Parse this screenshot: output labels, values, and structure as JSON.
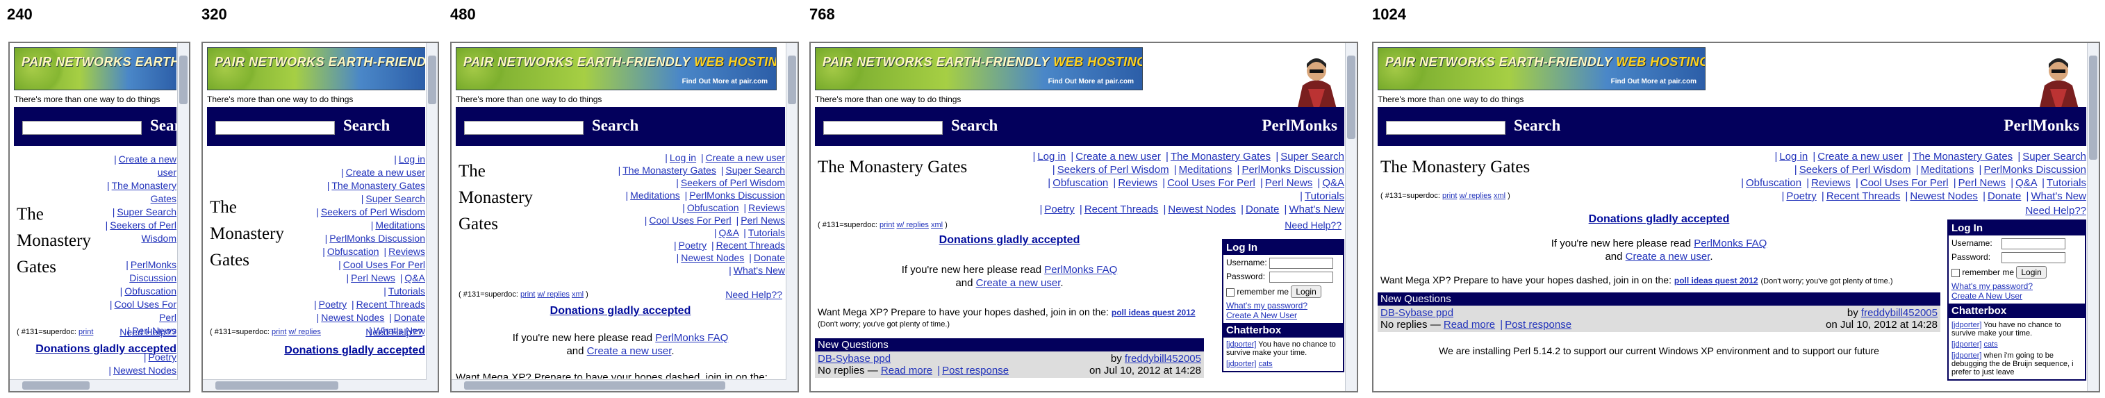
{
  "viewports": [
    {
      "label": "240"
    },
    {
      "label": "320"
    },
    {
      "label": "480"
    },
    {
      "label": "768"
    },
    {
      "label": "1024"
    }
  ],
  "banner": {
    "headline_a": "PAIR NETWORKS",
    "headline_b": "EARTH-FRIENDLY",
    "headline_c": "WEB HOSTING",
    "sub": "Find Out More at pair.com"
  },
  "tagline": "There's more than one way to do things",
  "search_label": "Search",
  "site_name": "PerlMonks",
  "page_title": "The Monastery Gates",
  "title_words": [
    "The",
    "Monastery",
    "Gates"
  ],
  "nav_links": [
    "Log in",
    "Create a new user",
    "The Monastery Gates",
    "Super Search",
    "Seekers of Perl Wisdom",
    "Meditations",
    "PerlMonks Discussion",
    "Obfuscation",
    "Reviews",
    "Cool Uses For Perl",
    "Perl News",
    "Q&A",
    "Tutorials",
    "Poetry",
    "Recent Threads",
    "Newest Nodes",
    "Donate",
    "What's New"
  ],
  "superdoc": {
    "prefix": "( #131=superdoc:",
    "print": "print",
    "replies": "w/ replies",
    "xml": "xml",
    "suffix": ")"
  },
  "need_help": "Need Help??",
  "donations": "Donations gladly accepted",
  "faq_line": {
    "pre": "If you're new here please read",
    "link": "PerlMonks FAQ",
    "and": "and",
    "link2": "Create a new user",
    "post": "."
  },
  "mega": {
    "pre": "Want Mega XP? Prepare to have your hopes dashed, join in on the:",
    "link": "poll ideas quest 2012",
    "post": "(Don't worry; you've got plenty of time.)"
  },
  "new_questions": {
    "heading": "New Questions",
    "title": "DB-Sybase ppd",
    "by": "by",
    "author": "freddybill452005",
    "date": "on Jul 10, 2012 at 14:28",
    "replies": "No replies —",
    "read_more": "Read more",
    "post_response": "Post response"
  },
  "login": {
    "heading": "Log In",
    "username": "Username:",
    "password": "Password:",
    "remember": "remember me",
    "button": "Login",
    "forgot": "What's my password?",
    "create": "Create A New User"
  },
  "chatterbox": {
    "heading": "Chatterbox",
    "lines": [
      {
        "who": "[jdporter]",
        "text": "You have no chance to survive make your time."
      },
      {
        "who": "[jdporter]",
        "text": "cats"
      },
      {
        "who": "[jdporter]",
        "text": "when i'm going to be debugging the de Bruijn sequence, i prefer to just leave"
      }
    ]
  },
  "installing": "We are installing Perl 5.14.2 to support our current Windows XP environment and to support our future"
}
